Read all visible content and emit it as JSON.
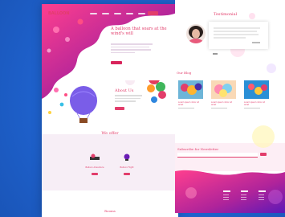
{
  "colors": {
    "accent": "#e23d6b",
    "frame": "#1f63cf",
    "purple": "#6a1cb5"
  },
  "landing": {
    "brand": "BALLOON",
    "hero_title": "A balloon that soars at the wind's will",
    "about_title": "About Us",
    "offer_title": "We offer",
    "offers": [
      {
        "title": "Balloon Adventure"
      },
      {
        "title": "Balloon Flight"
      }
    ],
    "footer_title": "Rooms"
  },
  "side": {
    "testimonial_title": "Testimonial",
    "blog_title": "Our Blog",
    "blog_posts": [
      {
        "title": "Lorem ipsum dolor sit amet"
      },
      {
        "title": "Lorem ipsum dolor sit amet"
      },
      {
        "title": "Lorem ipsum dolor sit amet"
      }
    ],
    "subscribe_title": "Subscribe for Newsletter",
    "footer_cols": [
      "About",
      "Links",
      "Help",
      "Contact"
    ]
  }
}
